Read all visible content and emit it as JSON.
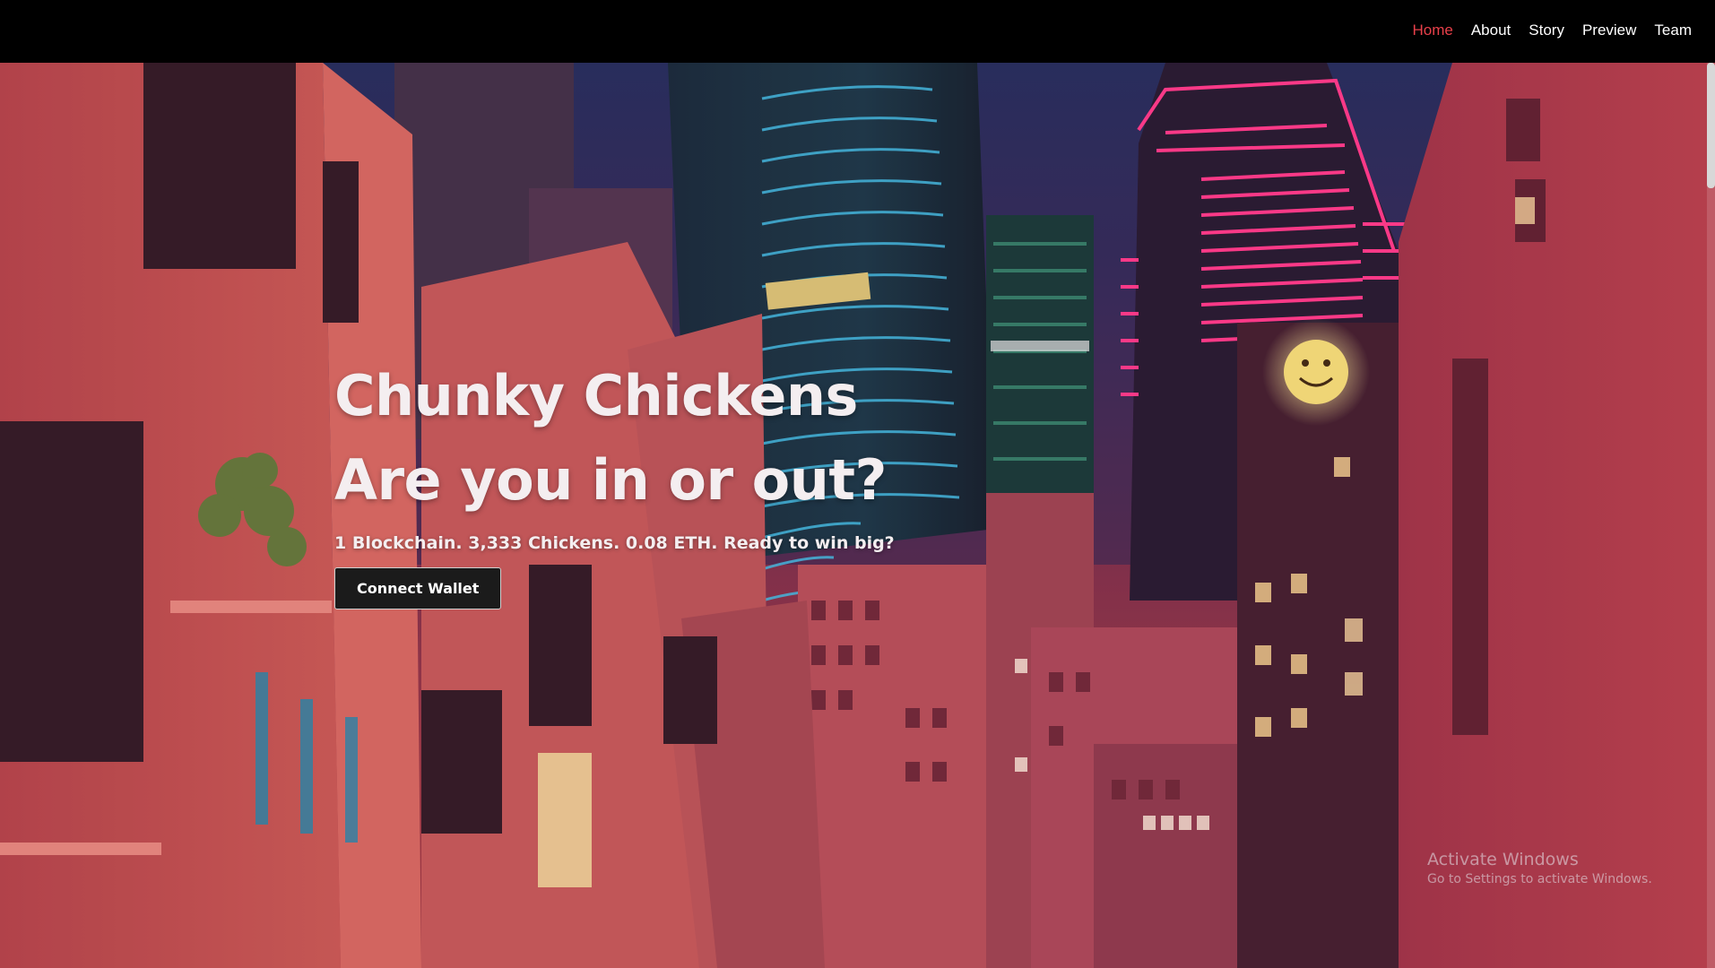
{
  "nav": {
    "items": [
      {
        "label": "Home",
        "active": true
      },
      {
        "label": "About",
        "active": false
      },
      {
        "label": "Story",
        "active": false
      },
      {
        "label": "Preview",
        "active": false
      },
      {
        "label": "Team",
        "active": false
      }
    ]
  },
  "hero": {
    "title_line1": "Chunky Chickens",
    "title_line2": "Are you in or out?",
    "subtitle": "1 Blockchain. 3,333 Chickens. 0.08 ETH. Ready to win big?",
    "cta_label": "Connect Wallet",
    "background": "neon-city-illustration"
  },
  "watermark": {
    "title": "Activate Windows",
    "subtitle": "Go to Settings to activate Windows."
  },
  "colors": {
    "nav_bg": "#000000",
    "nav_active": "#e8404a",
    "nav_text": "#ffffff",
    "button_bg": "#1b1b1b",
    "hero_text": "#f4eef0"
  }
}
